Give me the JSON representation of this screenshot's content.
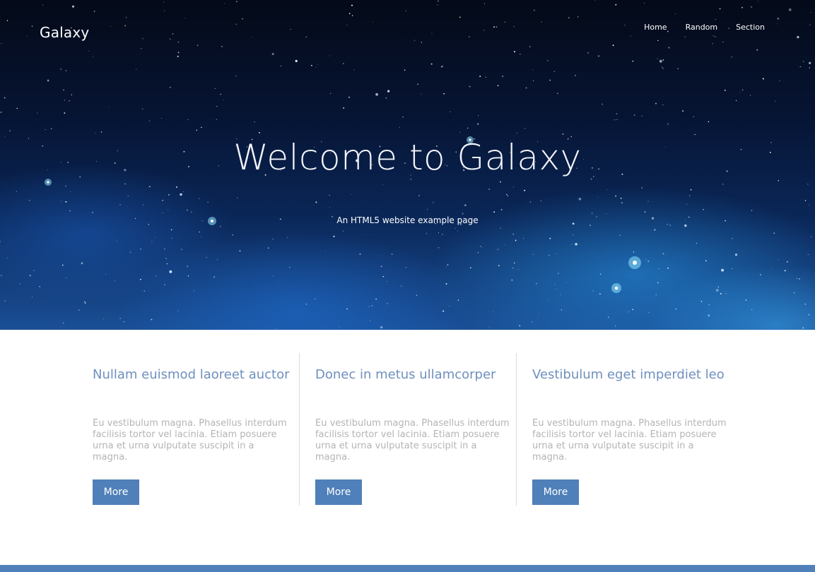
{
  "brand": {
    "name": "Galaxy"
  },
  "nav": {
    "items": [
      "Home",
      "Random",
      "Section"
    ]
  },
  "hero": {
    "title": "Welcome to Galaxy",
    "subtitle": "An HTML5 website example page"
  },
  "features": [
    {
      "title": "Nullam euismod laoreet auctor",
      "body": "Eu vestibulum magna. Phasellus interdum facilisis tortor vel lacinia. Etiam posuere urna et urna vulputate suscipit in a magna.",
      "button": "More"
    },
    {
      "title": "Donec in metus ullamcorper",
      "body": "Eu vestibulum magna. Phasellus interdum facilisis tortor vel lacinia. Etiam posuere urna et urna vulputate suscipit in a magna.",
      "button": "More"
    },
    {
      "title": "Vestibulum eget imperdiet leo",
      "body": "Eu vestibulum magna. Phasellus interdum facilisis tortor vel lacinia. Etiam posuere urna et urna vulputate suscipit in a magna.",
      "button": "More"
    }
  ],
  "colors": {
    "accent": "#4f80b9",
    "heading": "#6f8fbf",
    "body_text": "#b4b4b4",
    "hero_dark": "#061433"
  }
}
